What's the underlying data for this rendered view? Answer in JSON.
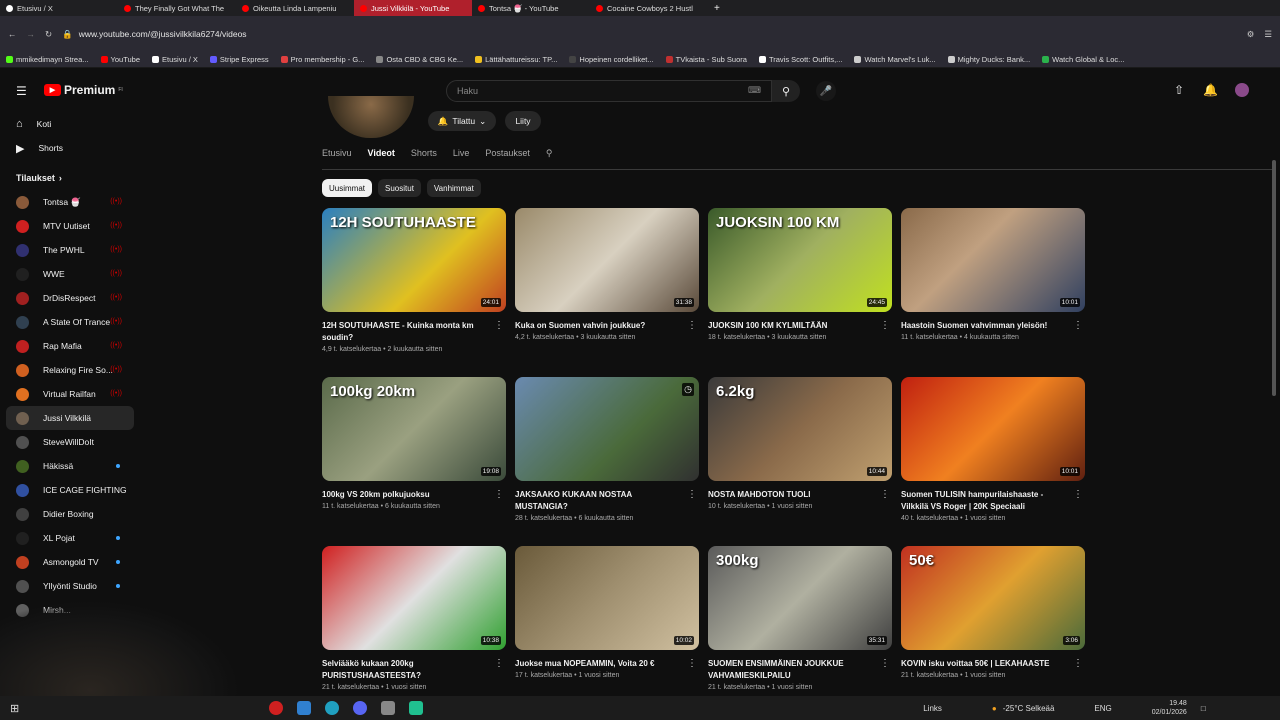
{
  "browser": {
    "tabs": [
      {
        "label": "Etusivu / X",
        "color": "#ffffff",
        "active": false
      },
      {
        "label": "They Finally Got What The",
        "color": "#ff0000",
        "active": false
      },
      {
        "label": "Oikeutta Linda Lampeniu",
        "color": "#ff0000",
        "active": false
      },
      {
        "label": "Jussi Vilkkilä - YouTube",
        "color": "#ff0000",
        "active": true
      },
      {
        "label": "Tontsa 🍧 - YouTube",
        "color": "#ff0000",
        "active": false
      },
      {
        "label": "Cocaine Cowboys 2 Hustl",
        "color": "#ff0000",
        "active": false
      }
    ],
    "url": "www.youtube.com/@jussivilkkila6274/videos",
    "bookmarks": [
      {
        "label": "mmikedimayn Strea...",
        "color": "#53fc18"
      },
      {
        "label": "YouTube",
        "color": "#ff0000"
      },
      {
        "label": "Etusivu / X",
        "color": "#ffffff"
      },
      {
        "label": "Stripe Express",
        "color": "#635bff"
      },
      {
        "label": "Pro membership - G...",
        "color": "#e04040"
      },
      {
        "label": "Osta CBD & CBG Ke...",
        "color": "#888888"
      },
      {
        "label": "Lättähattureissu: TP...",
        "color": "#f0c020"
      },
      {
        "label": "Hopeinen cordelliket...",
        "color": "#444444"
      },
      {
        "label": "TVkaista - Sub Suora",
        "color": "#c03030"
      },
      {
        "label": "Travis Scott: Outfits,...",
        "color": "#ffffff"
      },
      {
        "label": "Watch Marvel's Luk...",
        "color": "#cccccc"
      },
      {
        "label": "Mighty Ducks: Bank...",
        "color": "#cccccc"
      },
      {
        "label": "Watch Global & Loc...",
        "color": "#2bb24c"
      }
    ]
  },
  "youtube": {
    "brand": "Premium",
    "brand_sup": "FI",
    "search_placeholder": "Haku",
    "sidebar": {
      "main": [
        {
          "label": "Koti",
          "icon": "home-icon"
        },
        {
          "label": "Shorts",
          "icon": "shorts-icon"
        }
      ],
      "subs_header": "Tilaukset",
      "subs": [
        {
          "label": "Tontsa 🍧",
          "color": "#8a5a3a",
          "badge": "live"
        },
        {
          "label": "MTV Uutiset",
          "color": "#d02020",
          "badge": "live"
        },
        {
          "label": "The PWHL",
          "color": "#303070",
          "badge": "live"
        },
        {
          "label": "WWE",
          "color": "#202020",
          "badge": "live"
        },
        {
          "label": "DrDisRespect",
          "color": "#a02020",
          "badge": "live"
        },
        {
          "label": "A State Of Trance",
          "color": "#304050",
          "badge": "live"
        },
        {
          "label": "Rap Mafia",
          "color": "#c02020",
          "badge": "live"
        },
        {
          "label": "Relaxing Fire So...",
          "color": "#d06020",
          "badge": "live"
        },
        {
          "label": "Virtual Railfan",
          "color": "#e07020",
          "badge": "live"
        },
        {
          "label": "Jussi Vilkkilä",
          "color": "#706050",
          "badge": ""
        },
        {
          "label": "SteveWillDoIt",
          "color": "#505050",
          "badge": ""
        },
        {
          "label": "Häkissä",
          "color": "#406020",
          "badge": "dot"
        },
        {
          "label": "ICE CAGE FIGHTING",
          "color": "#3050a0",
          "badge": ""
        },
        {
          "label": "Didier Boxing",
          "color": "#404040",
          "badge": ""
        },
        {
          "label": "XL Pojat",
          "color": "#202020",
          "badge": "dot"
        },
        {
          "label": "Asmongold TV",
          "color": "#c04020",
          "badge": "dot"
        },
        {
          "label": "Yllyönti Studio",
          "color": "#505050",
          "badge": "dot"
        },
        {
          "label": "Mirsh...",
          "color": "#606060",
          "badge": ""
        }
      ]
    },
    "channel": {
      "subscribed_label": "Tilattu",
      "join_label": "Liity",
      "tabs": [
        "Etusivu",
        "Videot",
        "Shorts",
        "Live",
        "Postaukset"
      ],
      "active_tab": "Videot",
      "chips": [
        "Uusimmat",
        "Suositut",
        "Vanhimmat"
      ],
      "active_chip": "Uusimmat"
    },
    "videos": [
      {
        "title": "12H SOUTUHAASTE - Kuinka monta km soudin?",
        "meta": "4,9 t. katselukertaa • 2 kuukautta sitten",
        "duration": "24:01",
        "thumb_text": "12H SOUTUHAASTE",
        "bg": "linear-gradient(135deg,#2a7fc0,#e0c020 60%,#c04020)"
      },
      {
        "title": "Kuka on Suomen vahvin joukkue?",
        "meta": "4,2 t. katselukertaa • 3 kuukautta sitten",
        "duration": "31:38",
        "thumb_text": "",
        "bg": "linear-gradient(135deg,#9a8a6a,#d8d0c0 50%,#5a4a3a)"
      },
      {
        "title": "JUOKSIN 100 KM KYLMILTÄÄN",
        "meta": "18 t. katselukertaa • 3 kuukautta sitten",
        "duration": "24:45",
        "thumb_text": "JUOKSIN 100 KM",
        "bg": "linear-gradient(135deg,#3a5a2a,#a0b060 50%,#c0e020)"
      },
      {
        "title": "Haastoin Suomen vahvimman yleisön!",
        "meta": "11 t. katselukertaa • 4 kuukautta sitten",
        "duration": "10:01",
        "thumb_text": "",
        "bg": "linear-gradient(135deg,#8a6a4a,#c0a080 40%,#304060)"
      },
      {
        "title": "100kg VS 20km polkujuoksu",
        "meta": "11 t. katselukertaa • 6 kuukautta sitten",
        "duration": "19:08",
        "thumb_text": "100kg     20km",
        "bg": "linear-gradient(135deg,#5a6a4a,#9aa080 50%,#3a4a3a)"
      },
      {
        "title": "JAKSAAKO KUKAAN NOSTAA MUSTANGIA?",
        "meta": "28 t. katselukertaa • 6 kuukautta sitten",
        "duration": "",
        "thumb_text": "",
        "bg": "linear-gradient(135deg,#6a8ab0,#4a6a3a 60%,#303030)"
      },
      {
        "title": "NOSTA MAHDOTON TUOLI",
        "meta": "10 t. katselukertaa • 1 vuosi sitten",
        "duration": "10:44",
        "thumb_text": "6.2kg",
        "bg": "linear-gradient(135deg,#3a3a3a,#8a6a4a 50%,#c0a070)"
      },
      {
        "title": "Suomen TULISIN hampurilaishaaste - Vilkkilä VS Roger | 20K Speciaali",
        "meta": "40 t. katselukertaa • 1 vuosi sitten",
        "duration": "10:01",
        "thumb_text": "",
        "bg": "linear-gradient(135deg,#c02010,#f08020 50%,#602010)"
      },
      {
        "title": "Selviääkö kukaan 200kg PURISTUSHAASTEESTA?",
        "meta": "21 t. katselukertaa • 1 vuosi sitten",
        "duration": "10:38",
        "thumb_text": "",
        "bg": "linear-gradient(135deg,#d02020,#e0e0e0 50%,#30a030)"
      },
      {
        "title": "Juokse mua NOPEAMMIN, Voita 20 €",
        "meta": "17 t. katselukertaa • 1 vuosi sitten",
        "duration": "10:02",
        "thumb_text": "",
        "bg": "linear-gradient(135deg,#6a5a3a,#a09070 50%,#d0c0a0)"
      },
      {
        "title": "SUOMEN ENSIMMÄINEN JOUKKUE VAHVAMIESKILPAILU",
        "meta": "21 t. katselukertaa • 1 vuosi sitten",
        "duration": "35:31",
        "thumb_text": "300kg",
        "bg": "linear-gradient(135deg,#5a5a5a,#b0b0a0 50%,#404040)"
      },
      {
        "title": "KOVIN isku voittaa 50€ | LEKAHAASTE",
        "meta": "21 t. katselukertaa • 1 vuosi sitten",
        "duration": "3:06",
        "thumb_text": "50€",
        "bg": "linear-gradient(135deg,#c03020,#e0a030 50%,#4a6a3a)"
      }
    ]
  },
  "taskbar": {
    "links_label": "Links",
    "weather": "-25°C Selkeää",
    "lang": "ENG",
    "time": "19.48",
    "date": "02/01/2026"
  }
}
